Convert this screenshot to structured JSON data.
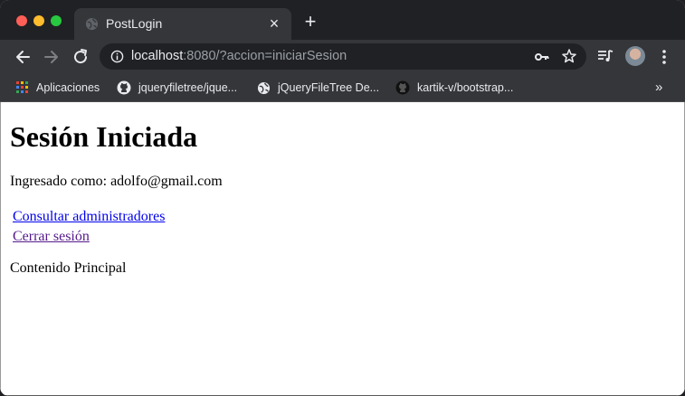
{
  "browser": {
    "tab_title": "PostLogin",
    "url_host": "localhost",
    "url_rest": ":8080/?accion=iniciarSesion",
    "bookmarks": [
      {
        "label": "Aplicaciones",
        "icon": "apps-grid-icon"
      },
      {
        "label": "jqueryfiletree/jque...",
        "icon": "github-icon"
      },
      {
        "label": "jQueryFileTree De...",
        "icon": "globe-icon"
      },
      {
        "label": "kartik-v/bootstrap...",
        "icon": "github-icon"
      }
    ],
    "more_bookmarks_glyph": "»",
    "new_tab_glyph": "+",
    "close_tab_glyph": "×"
  },
  "page": {
    "heading": "Sesión Iniciada",
    "logged_in_text": "Ingresado como: adolfo@gmail.com",
    "links": {
      "consultar": "Consultar administradores",
      "cerrar": "Cerrar sesión"
    },
    "main_content": "Contenido Principal"
  },
  "colors": {
    "link": "#0000ee",
    "visited_link": "#551a8b",
    "chrome_dark": "#202124",
    "chrome_toolbar": "#35363a"
  }
}
